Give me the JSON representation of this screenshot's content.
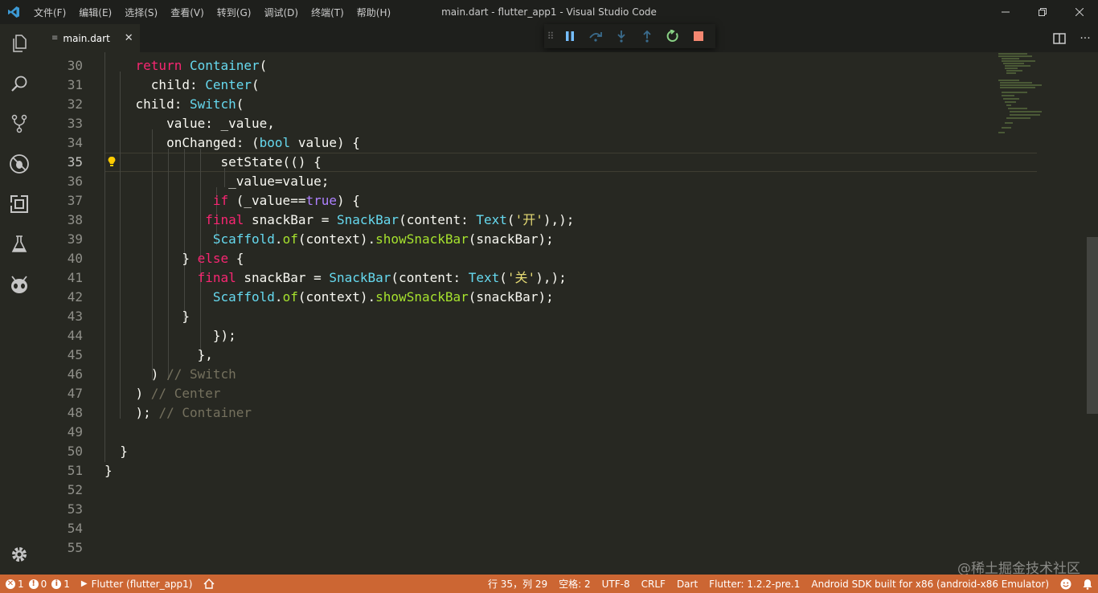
{
  "window": {
    "title": "main.dart - flutter_app1 - Visual Studio Code"
  },
  "menu": [
    "文件(F)",
    "编辑(E)",
    "选择(S)",
    "查看(V)",
    "转到(G)",
    "调试(D)",
    "终端(T)",
    "帮助(H)"
  ],
  "tab": {
    "label": "main.dart"
  },
  "activity_icons": [
    "explorer-icon",
    "search-icon",
    "source-control-icon",
    "debug-icon",
    "extensions-icon",
    "test-flask-icon",
    "alien-icon",
    "settings-gear-icon"
  ],
  "debug_toolbar": [
    "pause-icon",
    "step-over-icon",
    "step-into-icon",
    "step-out-icon",
    "restart-icon",
    "stop-icon"
  ],
  "editor": {
    "active_line": 35,
    "lines": [
      {
        "n": "30",
        "code": "    return Container("
      },
      {
        "n": "31",
        "code": "      child: Center("
      },
      {
        "n": "32",
        "code": "    child: Switch("
      },
      {
        "n": "33",
        "code": "        value: _value,"
      },
      {
        "n": "34",
        "code": "        onChanged: (bool value) {"
      },
      {
        "n": "35",
        "code": "               setState(() {"
      },
      {
        "n": "36",
        "code": "                _value=value;"
      },
      {
        "n": "37",
        "code": "              if (_value==true) {"
      },
      {
        "n": "38",
        "code": "             final snackBar = SnackBar(content: Text('开'),);"
      },
      {
        "n": "39",
        "code": "              Scaffold.of(context).showSnackBar(snackBar);"
      },
      {
        "n": "40",
        "code": "          } else {"
      },
      {
        "n": "41",
        "code": "            final snackBar = SnackBar(content: Text('关'),);"
      },
      {
        "n": "42",
        "code": "              Scaffold.of(context).showSnackBar(snackBar);"
      },
      {
        "n": "43",
        "code": "          }"
      },
      {
        "n": "44",
        "code": "              });"
      },
      {
        "n": "45",
        "code": "            },"
      },
      {
        "n": "46",
        "code": "      ) // Switch"
      },
      {
        "n": "47",
        "code": "    ) // Center"
      },
      {
        "n": "48",
        "code": "    ); // Container"
      },
      {
        "n": "49",
        "code": ""
      },
      {
        "n": "50",
        "code": "  }"
      },
      {
        "n": "51",
        "code": "}"
      },
      {
        "n": "52",
        "code": ""
      },
      {
        "n": "53",
        "code": ""
      },
      {
        "n": "54",
        "code": ""
      },
      {
        "n": "55",
        "code": ""
      }
    ]
  },
  "statusbar": {
    "errors": "1",
    "warnings": "0",
    "infos": "1",
    "launch": "Flutter (flutter_app1)",
    "position": "行 35，列 29",
    "spaces": "空格: 2",
    "encoding": "UTF-8",
    "eol": "CRLF",
    "language": "Dart",
    "flutter": "Flutter: 1.2.2-pre.1",
    "device": "Android SDK built for x86 (android-x86 Emulator)"
  },
  "watermark": "@稀土掘金技术社区",
  "colors": {
    "statusbar": "#cc6633",
    "editor_bg": "#272822",
    "titlebar": "#1e1f1c"
  }
}
